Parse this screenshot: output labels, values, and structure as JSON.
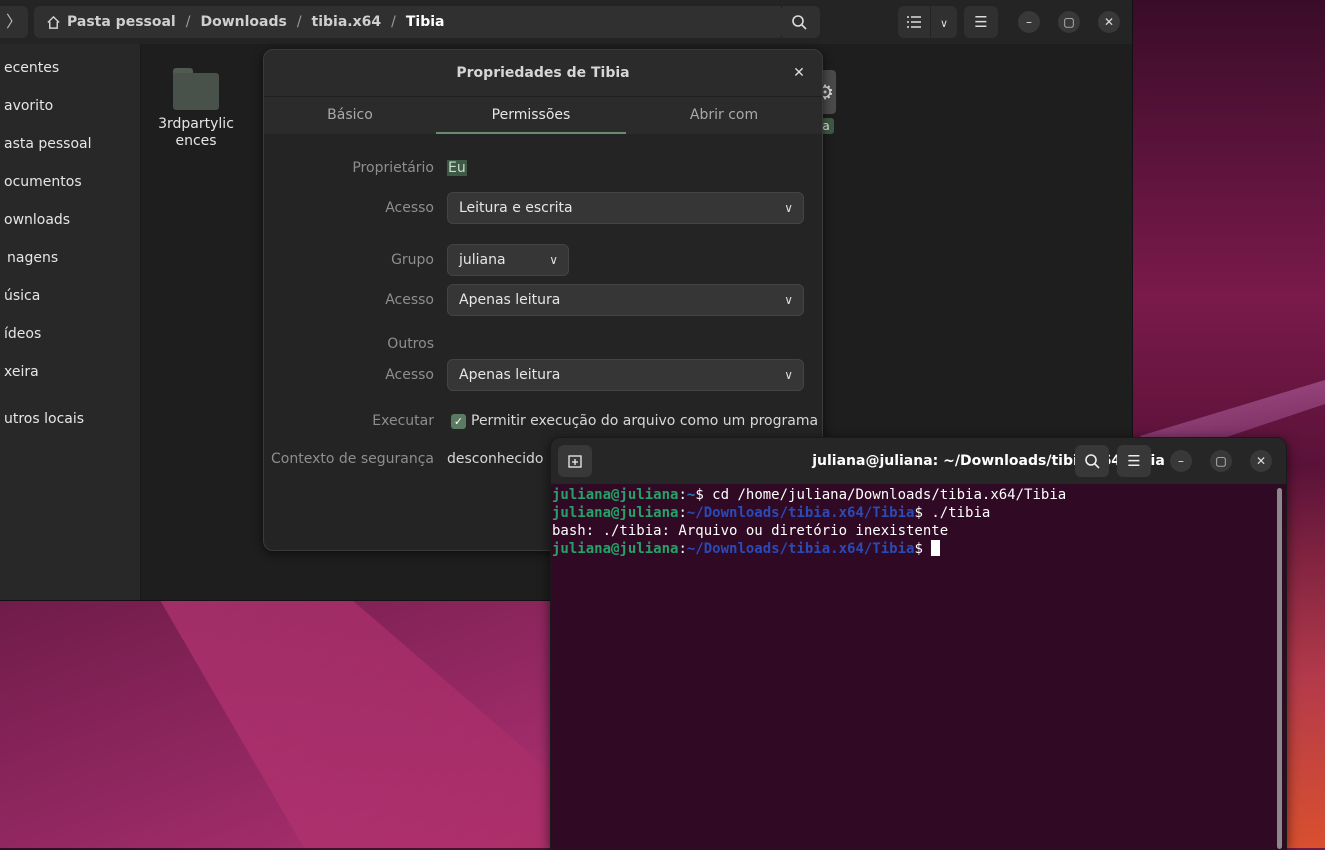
{
  "files_window": {
    "breadcrumb": [
      "Pasta pessoal",
      "Downloads",
      "tibia.x64",
      "Tibia"
    ],
    "separator": "/",
    "sidebar": [
      "Recentes",
      "Favorito",
      "Pasta pessoal",
      "Documentos",
      "Downloads",
      "Imagens",
      "Música",
      "Vídeos",
      "Lixeira",
      "Outros locais"
    ],
    "sidebar_visible": [
      "ecentes",
      "avorito",
      "asta pessoal",
      "ocumentos",
      "ownloads",
      "nagens",
      "úsica",
      "ídeos",
      "xeira",
      "utros locais"
    ],
    "items": [
      {
        "name_line1": "3rdpartylic",
        "name_line2": "ences"
      }
    ],
    "exec_label": "a"
  },
  "dialog": {
    "title": "Propriedades de Tibia",
    "tabs": [
      "Básico",
      "Permissões",
      "Abrir com"
    ],
    "active_tab": "Permissões",
    "owner_label": "Proprietário",
    "owner_value": "Eu",
    "access_label": "Acesso",
    "owner_access": "Leitura e escrita",
    "group_label": "Grupo",
    "group_value": "juliana",
    "group_access": "Apenas leitura",
    "others_label": "Outros",
    "others_access": "Apenas leitura",
    "execute_label": "Executar",
    "execute_checkbox": "Permitir execução do arquivo como um programa",
    "execute_checked": true,
    "security_label": "Contexto de segurança",
    "security_value": "desconhecido"
  },
  "terminal": {
    "title": "juliana@juliana: ~/Downloads/tibia.x64/Tibia",
    "lines": [
      {
        "user": "juliana@juliana",
        "path": "~",
        "cmd": "cd /home/juliana/Downloads/tibia.x64/Tibia"
      },
      {
        "user": "juliana@juliana",
        "path": "~/Downloads/tibia.x64/Tibia",
        "cmd": "./tibia"
      },
      {
        "output": "bash: ./tibia: Arquivo ou diretório inexistente"
      },
      {
        "user": "juliana@juliana",
        "path": "~/Downloads/tibia.x64/Tibia",
        "cmd": ""
      }
    ]
  },
  "colors": {
    "terminal_bg": "#300a24",
    "prompt_user": "#26a269",
    "prompt_path": "#2a4ab8",
    "accent": "#6b8a72"
  }
}
